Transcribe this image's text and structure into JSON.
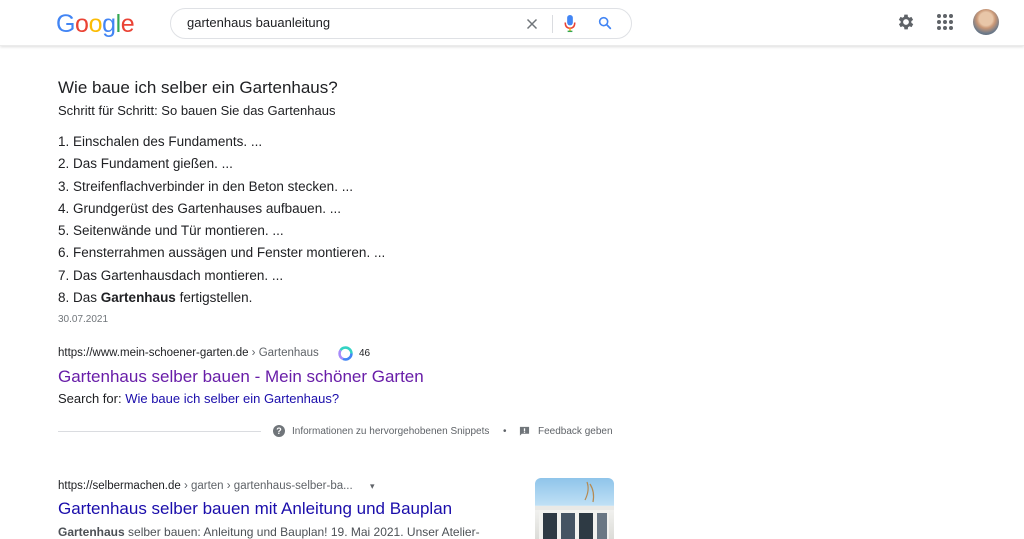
{
  "header": {
    "logo_letters": [
      {
        "ch": "G",
        "color": "#4285F4"
      },
      {
        "ch": "o",
        "color": "#EA4335"
      },
      {
        "ch": "o",
        "color": "#FBBC05"
      },
      {
        "ch": "g",
        "color": "#4285F4"
      },
      {
        "ch": "l",
        "color": "#34A853"
      },
      {
        "ch": "e",
        "color": "#EA4335"
      }
    ],
    "search_value": "gartenhaus bauanleitung",
    "icons": [
      "clear-icon",
      "microphone-icon",
      "search-icon",
      "gear-icon",
      "apps-grid-icon",
      "avatar"
    ]
  },
  "featured": {
    "question": "Wie baue ich selber ein Gartenhaus?",
    "subtitle": "Schritt für Schritt: So bauen Sie das Gartenhaus",
    "steps": [
      {
        "num": "1.",
        "pre": "Einschalen des Fundaments. ...",
        "bold": "",
        "post": ""
      },
      {
        "num": "2.",
        "pre": "Das Fundament gießen. ...",
        "bold": "",
        "post": ""
      },
      {
        "num": "3.",
        "pre": "Streifenflachverbinder in den Beton stecken. ...",
        "bold": "",
        "post": ""
      },
      {
        "num": "4.",
        "pre": "Grundgerüst des Gartenhauses aufbauen. ...",
        "bold": "",
        "post": ""
      },
      {
        "num": "5.",
        "pre": "Seitenwände und Tür montieren. ...",
        "bold": "",
        "post": ""
      },
      {
        "num": "6.",
        "pre": "Fensterrahmen aussägen und Fenster montieren. ...",
        "bold": "",
        "post": ""
      },
      {
        "num": "7.",
        "pre": "Das Gartenhausdach montieren. ...",
        "bold": "",
        "post": ""
      },
      {
        "num": "8.",
        "pre": "Das ",
        "bold": "Gartenhaus",
        "post": " fertigstellen."
      }
    ],
    "date": "30.07.2021",
    "source_url": "https://www.mein-schoener-garten.de",
    "source_crumb": " › Gartenhaus",
    "badge_count": "46",
    "title": "Gartenhaus selber bauen - Mein schöner Garten",
    "searchfor_label": "Search for: ",
    "searchfor_link": "Wie baue ich selber ein Gartenhaus?",
    "info_text": "Informationen zu hervorgehobenen Snippets",
    "separator": "•",
    "feedback_text": "Feedback geben",
    "colors": {
      "visited_link": "#681da8",
      "link": "#1a0dab"
    }
  },
  "result2": {
    "url": "https://selbermachen.de",
    "crumb": " › garten › gartenhaus-selber-ba...",
    "caret": "▾",
    "title": "Gartenhaus selber bauen mit Anleitung und Bauplan",
    "snippet_bold": "Gartenhaus",
    "snippet_rest": " selber bauen: Anleitung und Bauplan! 19. Mai 2021. Unser Atelier-"
  }
}
